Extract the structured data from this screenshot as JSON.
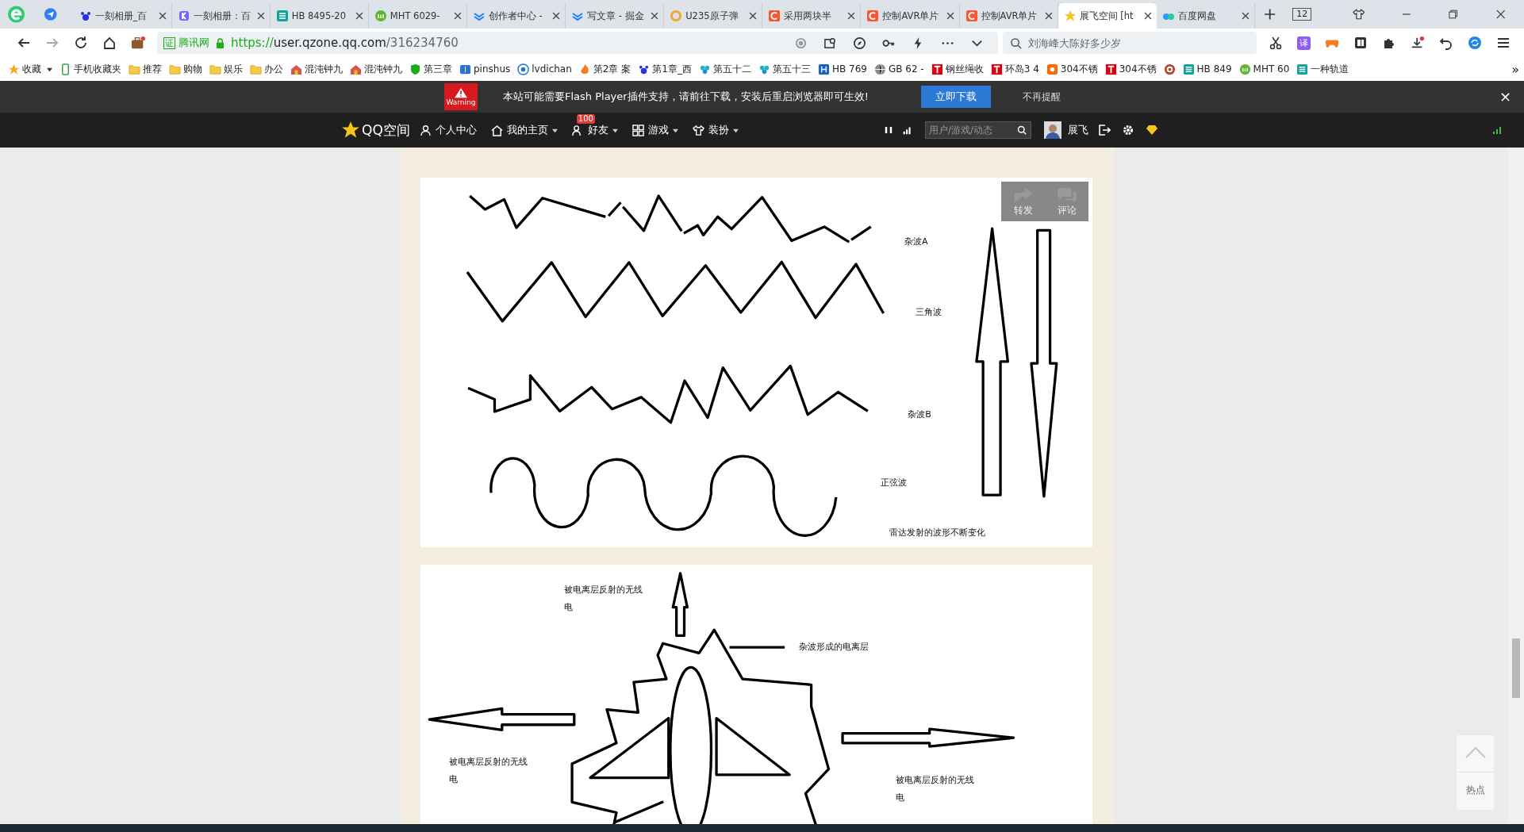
{
  "tabs": [
    {
      "label": "一刻相册_百",
      "kind": "paw",
      "selected": false
    },
    {
      "label": "一刻相册：百",
      "kind": "letter",
      "selected": false
    },
    {
      "label": "HB 8495-20",
      "kind": "doc",
      "selected": false
    },
    {
      "label": "MHT 6029-",
      "kind": "leaf",
      "selected": false
    },
    {
      "label": "创作者中心 -",
      "kind": "chevron",
      "selected": false
    },
    {
      "label": "写文章 - 掘金",
      "kind": "chevron",
      "selected": false
    },
    {
      "label": "U235原子弹",
      "kind": "ring",
      "selected": false
    },
    {
      "label": "采用两块半",
      "kind": "csdn",
      "selected": false
    },
    {
      "label": "控制AVR单片",
      "kind": "csdn",
      "selected": false
    },
    {
      "label": "控制AVR单片",
      "kind": "csdn",
      "selected": false
    },
    {
      "label": "展飞空间 [ht",
      "kind": "star",
      "selected": true
    },
    {
      "label": "百度网盘",
      "kind": "cloud",
      "selected": false
    }
  ],
  "tab_counter": "12",
  "address": {
    "badge": "证",
    "site": "腾讯网",
    "scheme": "https://",
    "host": "user.qzone.qq.com",
    "path": "/316234760"
  },
  "search": {
    "placeholder": "刘海峰大陈好多少岁"
  },
  "translate": "译",
  "bookmarks": [
    {
      "label": "收藏",
      "kind": "star"
    },
    {
      "label": "手机收藏夹",
      "kind": "phone"
    },
    {
      "label": "推荐",
      "kind": "folder"
    },
    {
      "label": "购物",
      "kind": "folder"
    },
    {
      "label": "娱乐",
      "kind": "folder"
    },
    {
      "label": "办公",
      "kind": "folder"
    },
    {
      "label": "混沌钟九",
      "kind": "house"
    },
    {
      "label": "混沌钟九",
      "kind": "house"
    },
    {
      "label": "第三章",
      "kind": "shield"
    },
    {
      "label": "pinshus",
      "kind": "book"
    },
    {
      "label": "lvdichan",
      "kind": "eye"
    },
    {
      "label": "第2章 案",
      "kind": "flame"
    },
    {
      "label": "第1章_西",
      "kind": "paw"
    },
    {
      "label": "第五十二",
      "kind": "flower"
    },
    {
      "label": "第五十三",
      "kind": "flower"
    },
    {
      "label": "HB 769",
      "kind": "grid"
    },
    {
      "label": "GB 62 -",
      "kind": "globe"
    },
    {
      "label": "钢丝绳收",
      "kind": "tee"
    },
    {
      "label": "环岛3 4",
      "kind": "tee"
    },
    {
      "label": "304不锈",
      "kind": "tao"
    },
    {
      "label": "304不锈",
      "kind": "tee"
    },
    {
      "kind": "target"
    },
    {
      "label": "HB 849",
      "kind": "doc"
    },
    {
      "label": "MHT 60",
      "kind": "leaf"
    },
    {
      "label": "一种轨道",
      "kind": "doc"
    }
  ],
  "bookmarks_more": "»",
  "flash_bar": {
    "warning": "Warning",
    "message": "本站可能需要Flash Player插件支持，请前往下载，安装后重启浏览器即可生效!",
    "download": "立即下载",
    "dismiss": "不再提醒",
    "close": "×"
  },
  "nav": {
    "logo": "QQ空间",
    "items": [
      {
        "label": "个人中心",
        "kind": "person",
        "dropdown": false
      },
      {
        "label": "我的主页",
        "kind": "home",
        "dropdown": true
      },
      {
        "label": "好友",
        "kind": "friends",
        "dropdown": true,
        "badge": "100"
      },
      {
        "label": "游戏",
        "kind": "grid",
        "dropdown": true
      },
      {
        "label": "装扮",
        "kind": "shirt",
        "dropdown": true
      }
    ],
    "search": {
      "placeholder": "用户/游戏/动态"
    },
    "user": "展飞"
  },
  "posts": [
    {
      "labels": [
        {
          "lines": [
            "杂波A"
          ]
        },
        {
          "lines": [
            "三角波"
          ]
        },
        {
          "lines": [
            "杂波B"
          ]
        },
        {
          "lines": [
            "正弦波"
          ]
        },
        {
          "lines": [
            "雷达发射的波形不断变化"
          ]
        }
      ],
      "actions": [
        "转发",
        "评论"
      ]
    },
    {
      "labels": [
        {
          "lines": [
            "被电离层反射的无线",
            "电"
          ]
        },
        {
          "lines": [
            "杂波形成的电离层"
          ]
        },
        {
          "lines": [
            "被电离层反射的无线",
            "电"
          ]
        },
        {
          "lines": [
            "被电离层反射的无线",
            "电"
          ]
        }
      ]
    }
  ],
  "hot": "热点"
}
